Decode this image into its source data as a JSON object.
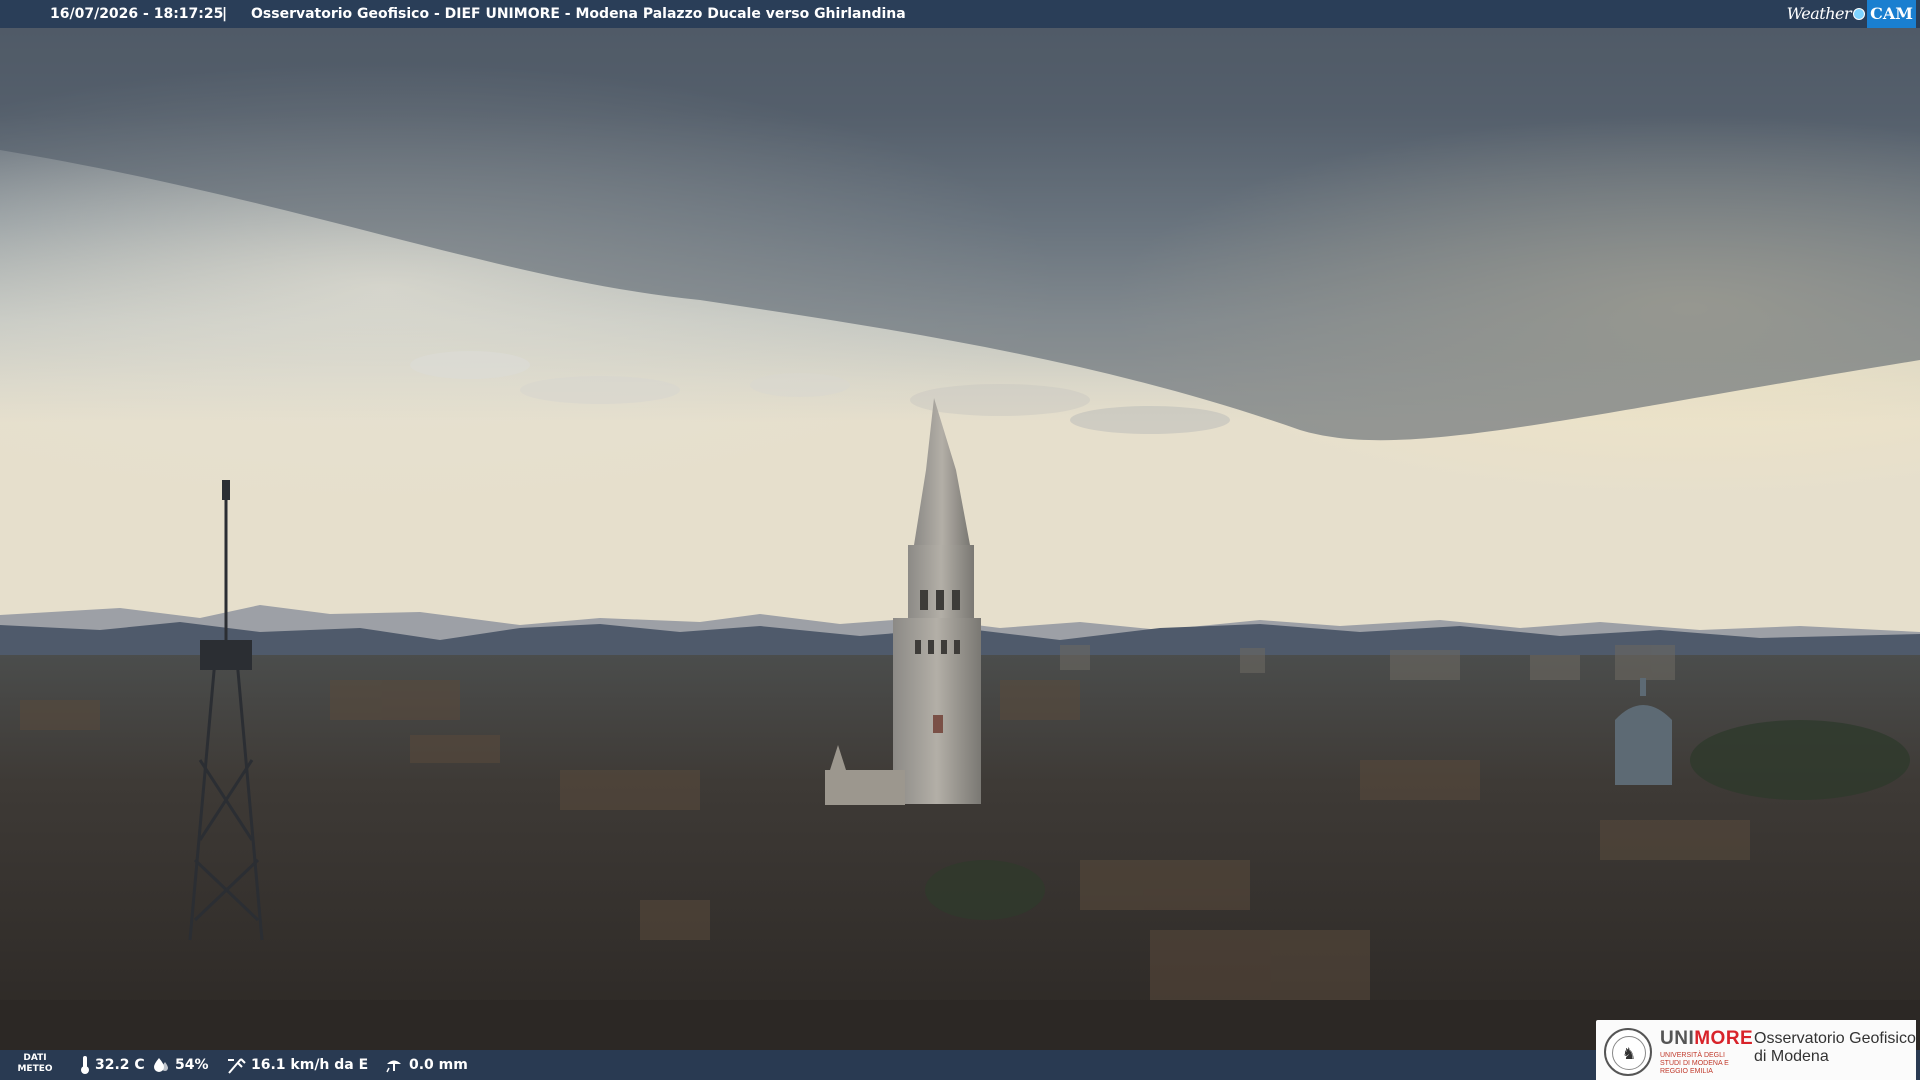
{
  "header": {
    "timestamp": "16/07/2026 - 18:17:25",
    "separator": "|",
    "title": "Osservatorio Geofisico - DIEF UNIMORE - Modena Palazzo Ducale verso Ghirlandina",
    "brand_weather": "Weather",
    "brand_cam": "CAM"
  },
  "weather": {
    "label_line1": "DATI",
    "label_line2": "METEO",
    "temperature": "32.2 C",
    "humidity": "54%",
    "wind": "16.1 km/h da E",
    "rain": "0.0 mm"
  },
  "logo": {
    "university_a": "UNI",
    "university_b": "MORE",
    "university_sub": "UNIVERSITÀ DEGLI STUDI DI MODENA E REGGIO EMILIA",
    "observatory_line1": "Osservatorio Geofisico",
    "observatory_line2": "di Modena"
  },
  "colors": {
    "bar": "#263a56",
    "sky_dark": "#5b6470",
    "sky_light": "#e9e2cf",
    "unimore_red": "#d8232a"
  }
}
